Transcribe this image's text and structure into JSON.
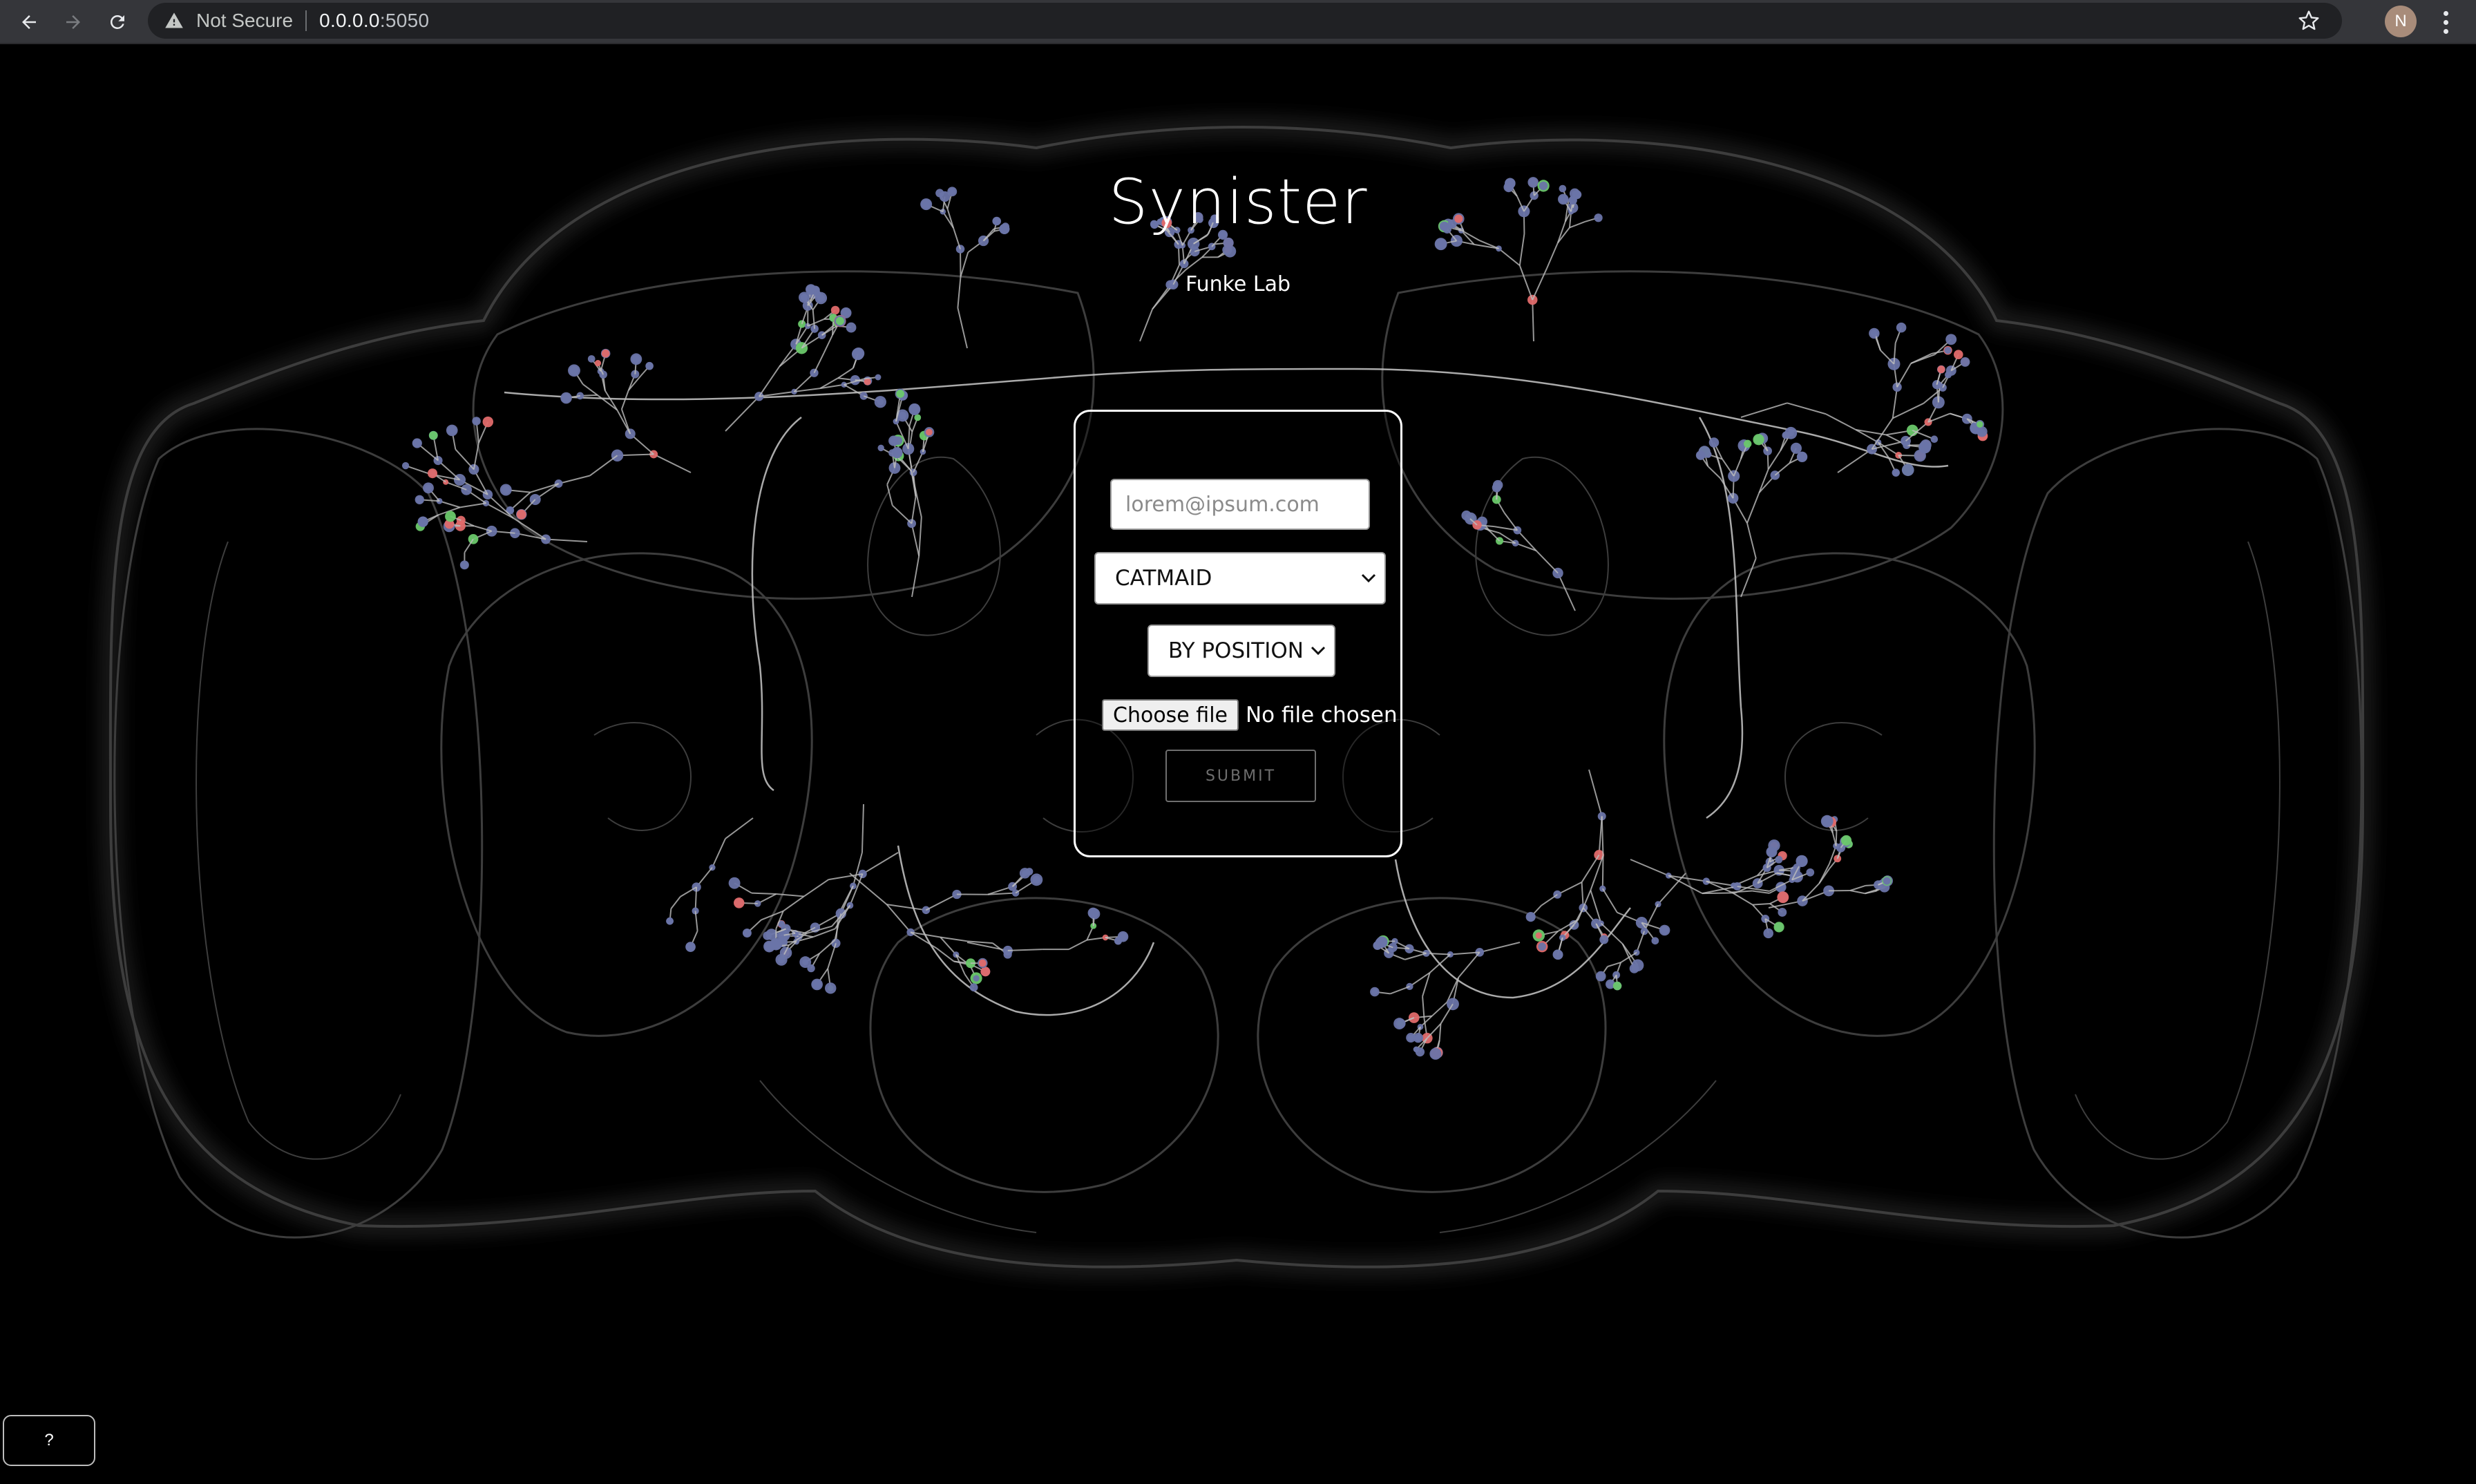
{
  "browser": {
    "security_label": "Not Secure",
    "url_host": "0.0.0.0",
    "url_port": ":5050",
    "profile_initial": "N"
  },
  "page": {
    "title": "Synister",
    "subtitle": "Funke Lab",
    "form": {
      "email_placeholder": "lorem@ipsum.com",
      "email_value": "",
      "database_select": "CATMAID",
      "mode_select": "BY POSITION",
      "choose_file_label": "Choose file",
      "file_status": "No file chosen",
      "submit_label": "SUBMIT"
    },
    "help_label": "?"
  },
  "colors": {
    "background": "#000000",
    "chrome": "#35363a",
    "omnibox": "#202124",
    "neuron_nodes": "#6a74a8",
    "neuron_red": "#e06a6a",
    "neuron_green": "#6ac86a"
  }
}
